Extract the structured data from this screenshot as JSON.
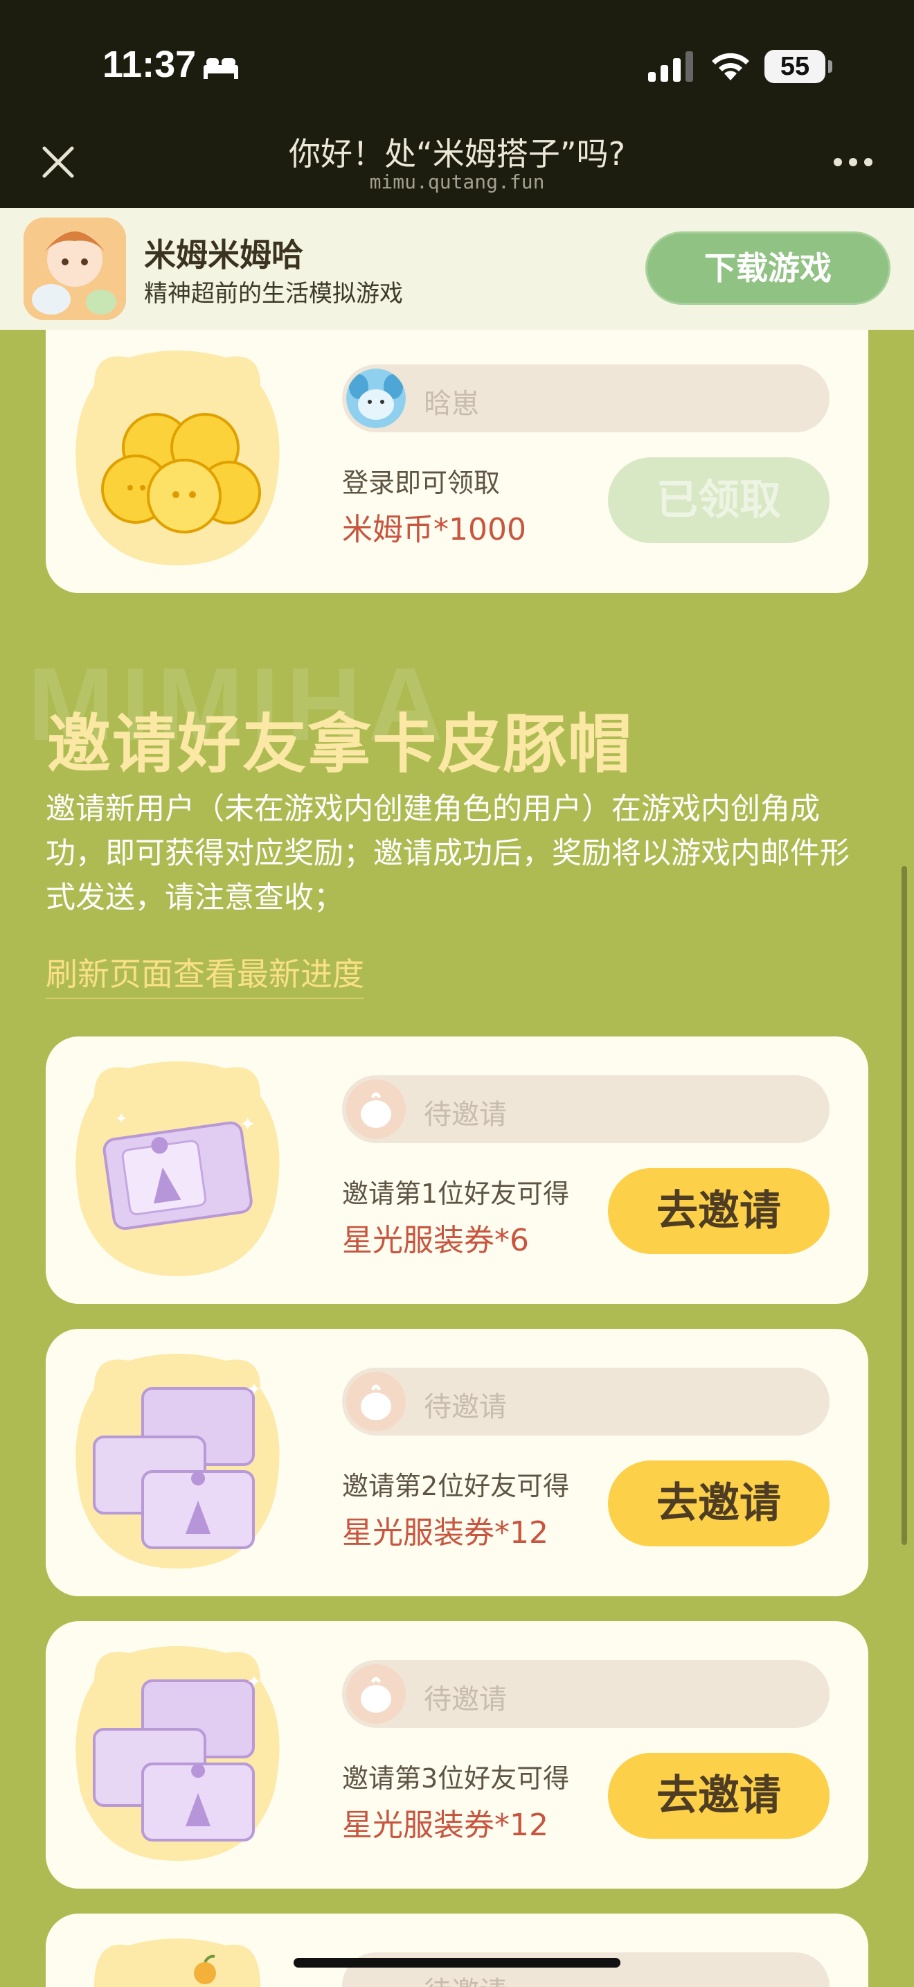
{
  "status_bar": {
    "time": "11:37",
    "battery": "55"
  },
  "browser": {
    "title": "你好！处“米姆搭子”吗?",
    "url": "mimu.qutang.fun"
  },
  "app_banner": {
    "name": "米姆米姆哈",
    "desc": "精神超前的生活模拟游戏",
    "download_label": "下载游戏"
  },
  "login_card": {
    "user_name": "晗崽",
    "label": "登录即可领取",
    "reward": "米姆币*1000",
    "button": "已领取"
  },
  "invite_section": {
    "watermark": "MIMIHA",
    "title": "邀请好友拿卡皮豚帽",
    "description": "邀请新用户（未在游戏内创建角色的用户）在游戏内创角成功，即可获得对应奖励；邀请成功后，奖励将以游戏内邮件形式发送，请注意查收；",
    "refresh_link": "刷新页面查看最新进度"
  },
  "invite_cards": [
    {
      "status": "待邀请",
      "label": "邀请第1位好友可得",
      "reward": "星光服装券*6",
      "button": "去邀请"
    },
    {
      "status": "待邀请",
      "label": "邀请第2位好友可得",
      "reward": "星光服装券*12",
      "button": "去邀请"
    },
    {
      "status": "待邀请",
      "label": "邀请第3位好友可得",
      "reward": "星光服装券*12",
      "button": "去邀请"
    },
    {
      "status": "待邀请"
    }
  ],
  "colors": {
    "page_bg": "#aebb52",
    "card_bg": "#fffdf0",
    "invite_button": "#fdd04a",
    "reward_text": "#c8553f",
    "download_button": "#90c283"
  }
}
